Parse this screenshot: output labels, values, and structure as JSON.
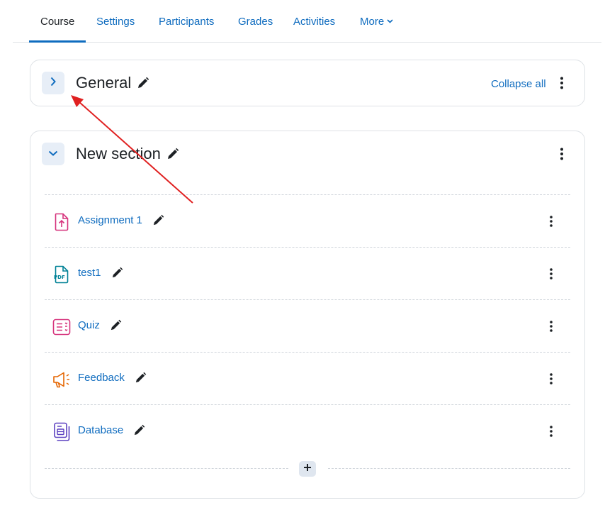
{
  "tabs": [
    {
      "label": "Course",
      "active": true
    },
    {
      "label": "Settings"
    },
    {
      "label": "Participants"
    },
    {
      "label": "Grades"
    },
    {
      "label": "Activities"
    },
    {
      "label": "More"
    }
  ],
  "sections": {
    "general": {
      "title": "General",
      "collapse_all_label": "Collapse all",
      "expanded": false
    },
    "new_section": {
      "title": "New section",
      "expanded": true,
      "activities": [
        {
          "name": "Assignment 1",
          "icon": "assignment-icon",
          "color": "#d6337c"
        },
        {
          "name": "test1",
          "icon": "pdf-file-icon",
          "color": "#008196"
        },
        {
          "name": "Quiz",
          "icon": "quiz-icon",
          "color": "#d6337c"
        },
        {
          "name": "Feedback",
          "icon": "megaphone-icon",
          "color": "#e56500"
        },
        {
          "name": "Database",
          "icon": "database-icon",
          "color": "#5b40c0"
        }
      ]
    }
  },
  "icon_pdf_text": "PDF",
  "colors": {
    "link": "#0f6cbf",
    "text": "#1d2125",
    "annotation_arrow": "#e02020"
  }
}
